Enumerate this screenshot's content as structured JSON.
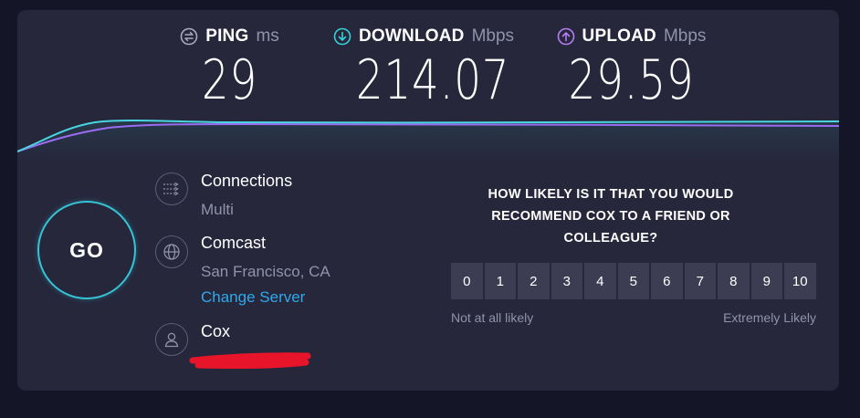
{
  "metrics": {
    "ping": {
      "label": "PING",
      "unit": "ms",
      "value": "29",
      "icon": "ping-icon",
      "color": "#a9abbd"
    },
    "download": {
      "label": "DOWNLOAD",
      "unit": "Mbps",
      "value": "214.07",
      "icon": "download-arrow-icon",
      "color": "#36d0d6"
    },
    "upload": {
      "label": "UPLOAD",
      "unit": "Mbps",
      "value": "29.59",
      "icon": "upload-arrow-icon",
      "color": "#b57cf3"
    }
  },
  "go_button": {
    "label": "GO"
  },
  "server": {
    "connections": {
      "title": "Connections",
      "value": "Multi",
      "icon": "connections-icon"
    },
    "host": {
      "title": "Comcast",
      "location": "San Francisco, CA",
      "icon": "globe-icon"
    },
    "change_server_label": "Change Server",
    "provider": {
      "title": "Cox",
      "icon": "user-icon"
    }
  },
  "survey": {
    "question_lines": [
      "HOW LIKELY IS IT THAT YOU WOULD",
      "RECOMMEND COX TO A FRIEND OR",
      "COLLEAGUE?"
    ],
    "options": [
      "0",
      "1",
      "2",
      "3",
      "4",
      "5",
      "6",
      "7",
      "8",
      "9",
      "10"
    ],
    "low_label": "Not at all likely",
    "high_label": "Extremely Likely"
  },
  "colors": {
    "background": "#141526",
    "card": "#26273b",
    "accent_download": "#36d0d6",
    "accent_upload": "#b57cf3",
    "link": "#2fa8ec",
    "redaction": "#e8152a"
  }
}
